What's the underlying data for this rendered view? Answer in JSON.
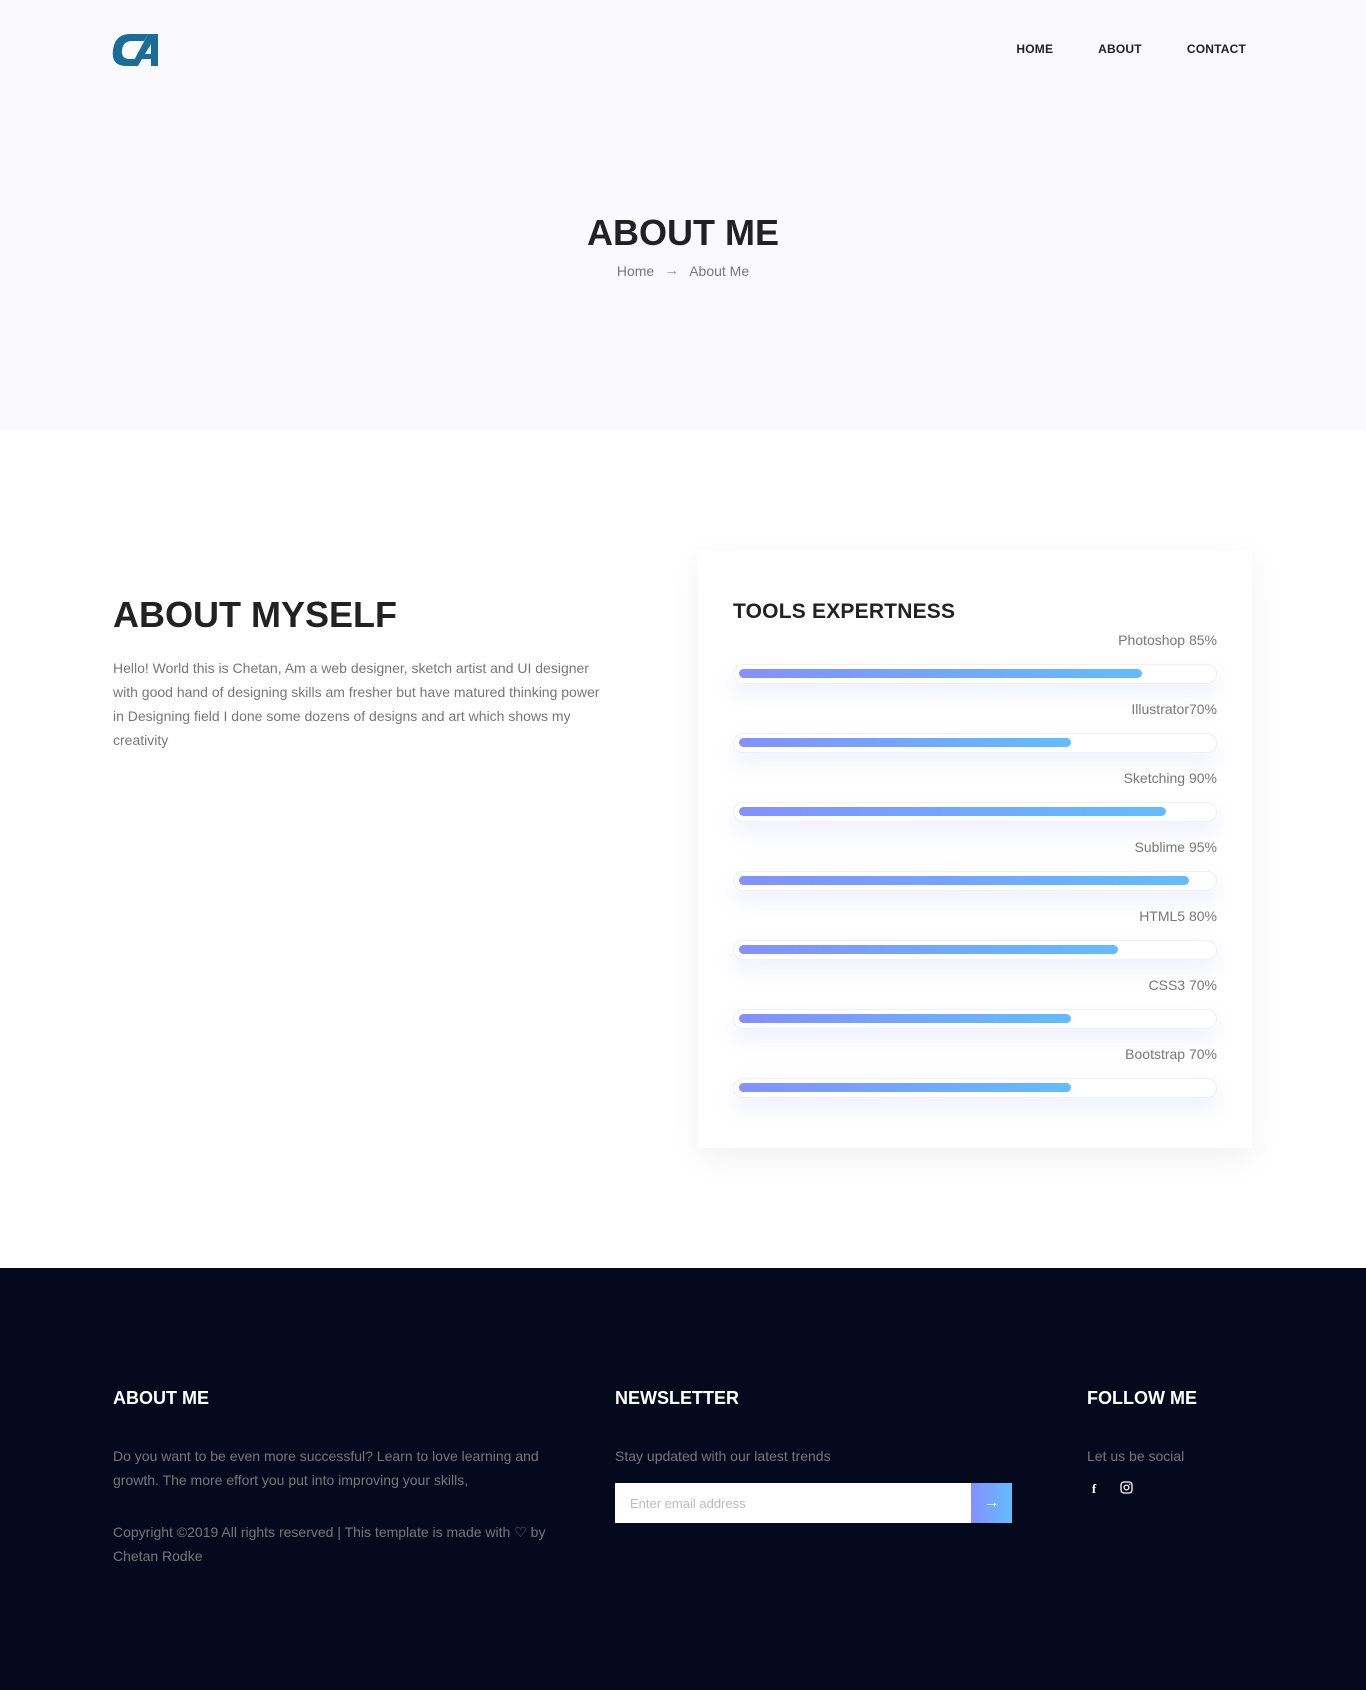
{
  "nav": {
    "items": [
      "HOME",
      "ABOUT",
      "CONTACT"
    ]
  },
  "hero": {
    "title": "ABOUT ME",
    "breadcrumb": {
      "home": "Home",
      "arrow": "→",
      "current": "About Me"
    }
  },
  "about": {
    "title": "ABOUT MYSELF",
    "text": "Hello! World this is Chetan, Am a web designer, sketch artist and UI designer with good hand of designing skills am fresher but have matured thinking power in Designing field I done some dozens of designs and art which shows my creativity"
  },
  "tools": {
    "title": "TOOLS EXPERTNESS",
    "skills": [
      {
        "label": "Photoshop 85%",
        "percent": 85
      },
      {
        "label": "Illustrator70%",
        "percent": 70
      },
      {
        "label": "Sketching 90%",
        "percent": 90
      },
      {
        "label": "Sublime 95%",
        "percent": 95
      },
      {
        "label": "HTML5 80%",
        "percent": 80
      },
      {
        "label": "CSS3 70%",
        "percent": 70
      },
      {
        "label": "Bootstrap 70%",
        "percent": 70
      }
    ]
  },
  "footer": {
    "about": {
      "title": "ABOUT ME",
      "text": "Do you want to be even more successful? Learn to love learning and growth. The more effort you put into improving your skills,",
      "copyright_before": "Copyright ©2019 All rights reserved | This template is made with",
      "heart": "♡",
      "copyright_after": "by Chetan Rodke"
    },
    "newsletter": {
      "title": "NEWSLETTER",
      "text": "Stay updated with our latest trends",
      "placeholder": "Enter email address",
      "button_icon": "→"
    },
    "follow": {
      "title": "FOLLOW ME",
      "text": "Let us be social",
      "icons": [
        "facebook-icon",
        "instagram-icon"
      ]
    }
  },
  "colors": {
    "hero_bg": "#f9f9fe",
    "footer_bg": "#04091e",
    "bar_gradient_start": "#8490ff",
    "bar_gradient_end": "#62bdfc",
    "logo": "#1a6d99"
  }
}
